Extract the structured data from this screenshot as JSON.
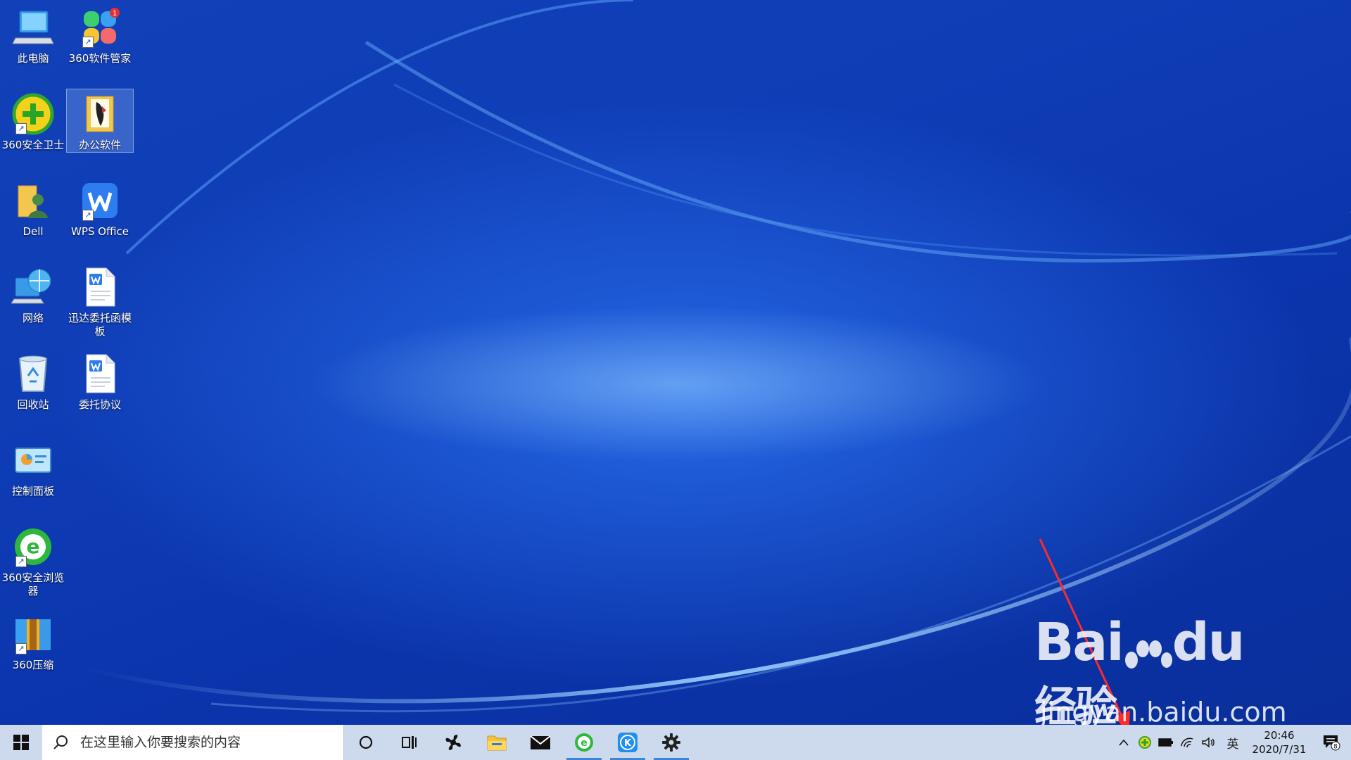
{
  "desktop": {
    "icons": [
      {
        "label": "此电脑"
      },
      {
        "label": "360软件管家"
      },
      {
        "label": "360安全卫士"
      },
      {
        "label": "办公软件"
      },
      {
        "label": "Dell"
      },
      {
        "label": "WPS Office"
      },
      {
        "label": "网络"
      },
      {
        "label": "迅达委托函模板"
      },
      {
        "label": "回收站"
      },
      {
        "label": "委托协议"
      },
      {
        "label": "控制面板"
      },
      {
        "label": "360安全浏览器"
      },
      {
        "label": "360压缩"
      }
    ],
    "badge_count": "1"
  },
  "watermark": {
    "brand": "Bai",
    "brand2": "du",
    "brand_cn": "经验",
    "url": "jingyan.baidu.com"
  },
  "taskbar": {
    "search_placeholder": "在这里输入你要搜索的内容",
    "ime_label": "英",
    "time": "20:46",
    "date": "2020/7/31",
    "notification_count": "8"
  },
  "colors": {
    "accent": "#3a86d8",
    "taskbar_bg": "#cdd9ec",
    "arrow": "#ff2a2a"
  }
}
